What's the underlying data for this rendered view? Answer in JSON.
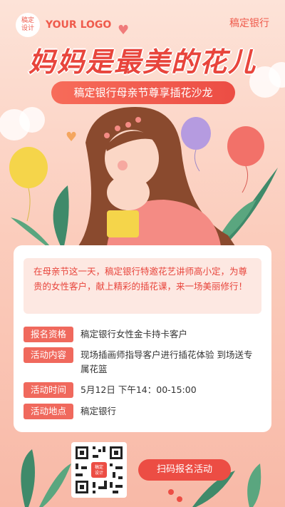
{
  "header": {
    "logo_badge": "稿定\n设计",
    "logo_text": "YOUR LOGO",
    "brand": "稿定银行"
  },
  "hero": {
    "title": "妈妈是最美的花儿",
    "subtitle": "稿定银行母亲节尊享插花沙龙"
  },
  "intro": "在母亲节这一天，稿定银行特邀花艺讲师高小定，为尊贵的女性客户，献上精彩的插花课，来一场美丽修行！",
  "details": [
    {
      "label": "报名资格",
      "value": "稿定银行女性金卡持卡客户"
    },
    {
      "label": "活动内容",
      "value": "现场插画师指导客户进行插花体验 到场送专属花篮"
    },
    {
      "label": "活动时间",
      "value": "5月12日 下午14：00-15:00"
    },
    {
      "label": "活动地点",
      "value": "稿定银行"
    }
  ],
  "cta": {
    "qr_center": "稿定\n设计",
    "button": "扫码报名活动"
  },
  "colors": {
    "accent": "#ec4d44",
    "tag": "#f0695d",
    "background": "#fbcdbd"
  },
  "icons": [
    "heart-icon",
    "balloon-icon",
    "leaf-icon",
    "qr-code-icon"
  ]
}
